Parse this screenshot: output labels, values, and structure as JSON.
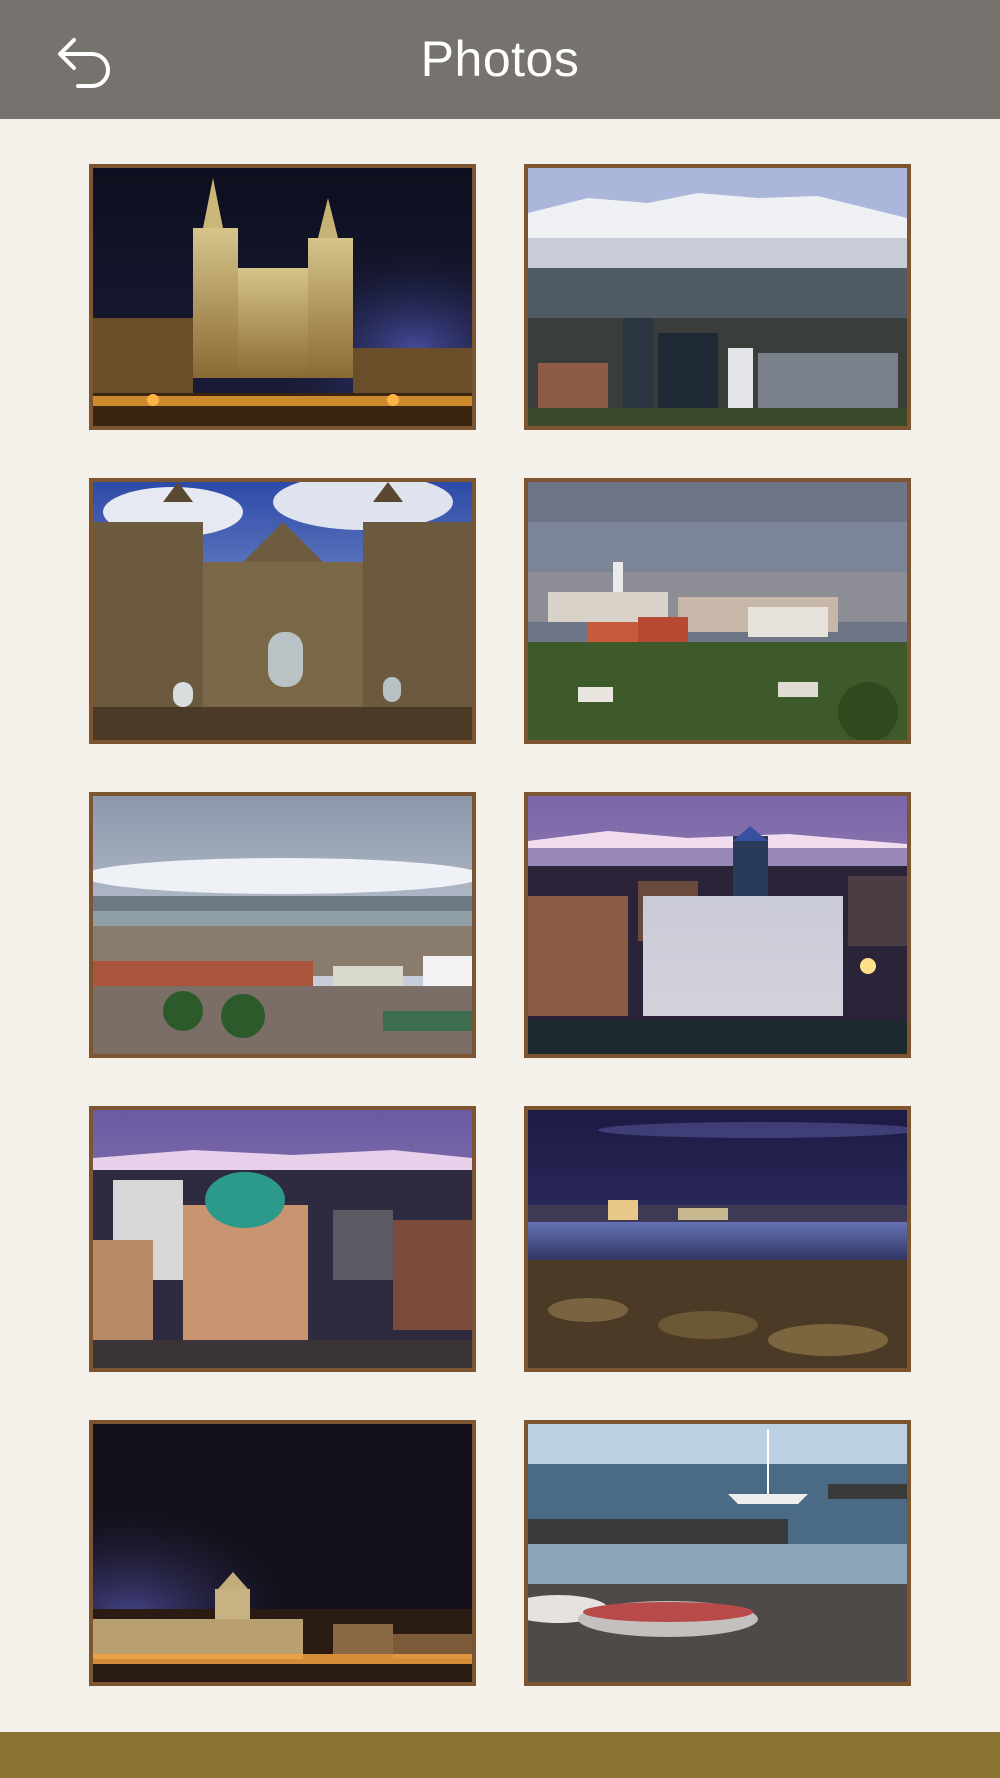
{
  "header": {
    "title": "Photos",
    "back_icon": "back-arrow-icon"
  },
  "photos": [
    {
      "subject": "cathedral-night"
    },
    {
      "subject": "snowy-mountains-city"
    },
    {
      "subject": "cathedral-facade-day"
    },
    {
      "subject": "city-panorama-green"
    },
    {
      "subject": "harbor-town-cloudy"
    },
    {
      "subject": "city-buildings-dusk"
    },
    {
      "subject": "highrise-dome-dusk"
    },
    {
      "subject": "waterfront-night"
    },
    {
      "subject": "palace-night-floodlight"
    },
    {
      "subject": "beach-boats-sea"
    }
  ],
  "colors": {
    "header_bg": "#76726d",
    "page_bg": "#f4f1ea",
    "frame": "#7d5631",
    "footer_bg": "#8b7334"
  }
}
